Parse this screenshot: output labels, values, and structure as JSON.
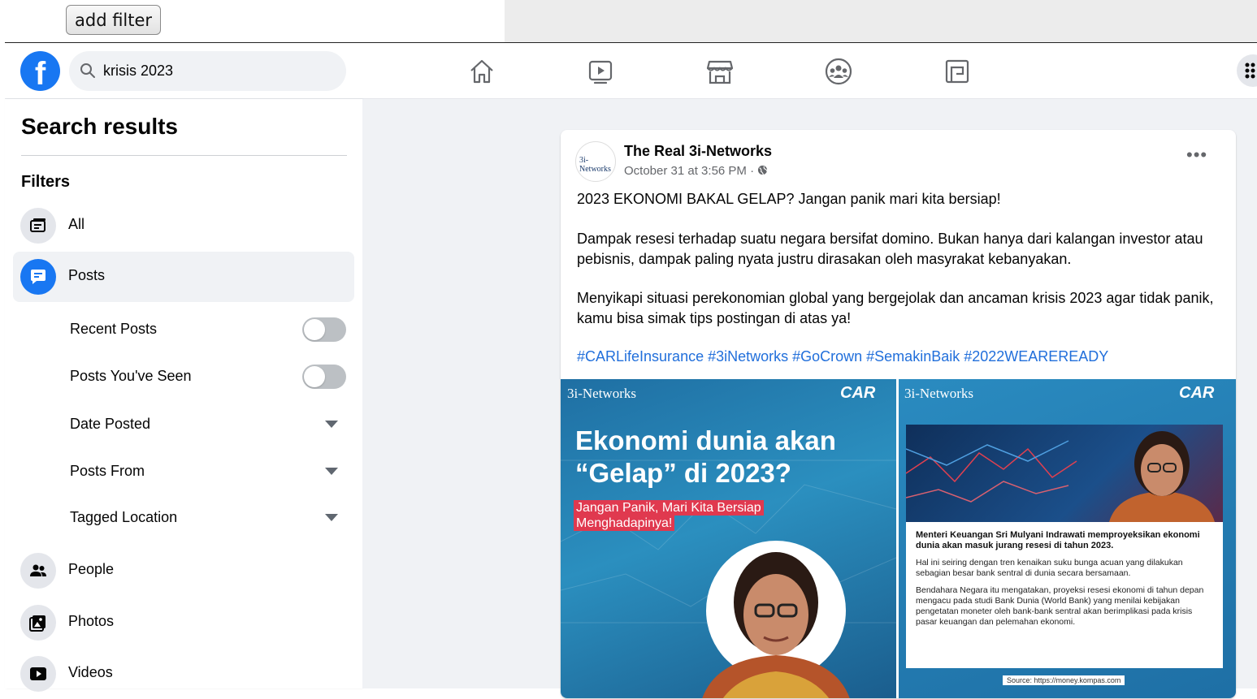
{
  "debug": {
    "add_filter_label": "add filter"
  },
  "navbar": {
    "logo_letter": "f",
    "search_value": "krisis 2023"
  },
  "sidebar": {
    "title": "Search results",
    "filters_title": "Filters",
    "items": [
      {
        "label": "All",
        "icon": "all-icon"
      },
      {
        "label": "Posts",
        "icon": "posts-icon",
        "active": true
      },
      {
        "label": "People",
        "icon": "people-icon"
      },
      {
        "label": "Photos",
        "icon": "photos-icon"
      },
      {
        "label": "Videos",
        "icon": "videos-icon"
      }
    ],
    "post_filters": {
      "recent_posts": "Recent Posts",
      "posts_seen": "Posts You've Seen",
      "date_posted": "Date Posted",
      "posts_from": "Posts From",
      "tagged_location": "Tagged Location"
    }
  },
  "post": {
    "author": "The Real 3i-Networks",
    "avatar_text": "3i-Networks",
    "date": "October 31 at 3:56 PM · ",
    "more": "•••",
    "paragraphs": [
      "2023 EKONOMI BAKAL GELAP? Jangan panik mari kita bersiap!",
      "Dampak resesi terhadap suatu negara bersifat domino. Bukan hanya dari kalangan investor atau pebisnis, dampak paling nyata justru dirasakan oleh masyrakat kebanyakan.",
      "Menyikapi situasi perekonomian global yang bergejolak dan ancaman krisis 2023 agar tidak panik, kamu bisa simak tips postingan di atas ya!"
    ],
    "hashtags": "#CARLifeInsurance #3iNetworks #GoCrown #SemakinBaik #2022WEAREREADY",
    "image_left": {
      "brand": "3i-Networks",
      "car": "CAR",
      "headline_1": "Ekonomi dunia akan",
      "headline_2": "“Gelap” di 2023?",
      "sub_1": "Jangan Panik, Mari Kita Bersiap",
      "sub_2": "Menghadapinya!"
    },
    "image_right": {
      "brand": "3i-Networks",
      "car": "CAR",
      "heading": "Menteri Keuangan Sri Mulyani Indrawati memproyeksikan ekonomi dunia akan masuk jurang resesi di tahun 2023.",
      "para_1": "Hal ini seiring dengan tren kenaikan suku bunga acuan yang dilakukan sebagian besar bank sentral di dunia secara bersamaan.",
      "para_2": "Bendahara Negara itu mengatakan, proyeksi resesi ekonomi di tahun depan mengacu pada studi Bank Dunia (World Bank) yang menilai kebijakan pengetatan moneter oleh bank-bank sentral akan berimplikasi pada krisis pasar keuangan dan pelemahan ekonomi.",
      "source": "Source: https://money.kompas.com"
    }
  },
  "colors": {
    "brand": "#1877f2",
    "hashtag": "#216fdb",
    "background": "#f0f2f5"
  }
}
